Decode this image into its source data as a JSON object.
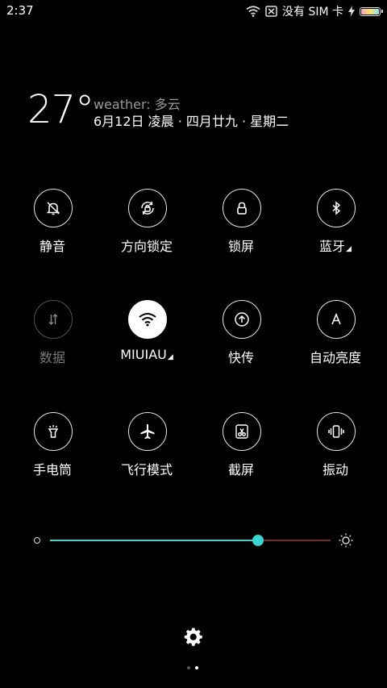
{
  "status_bar": {
    "time": "2:37",
    "carrier": "没有 SIM 卡",
    "battery_level": 1.0
  },
  "weather": {
    "temperature": "27°",
    "summary": "weather:  多云",
    "date": "6月12日 凌晨 · 四月廿九 · 星期二"
  },
  "toggles": [
    {
      "label": "静音",
      "icon": "silent-bell-icon",
      "state": "on"
    },
    {
      "label": "方向锁定",
      "icon": "rotation-lock-icon",
      "state": "on"
    },
    {
      "label": "锁屏",
      "icon": "lock-icon",
      "state": "on"
    },
    {
      "label": "蓝牙",
      "icon": "bluetooth-icon",
      "state": "on",
      "has_menu": true
    },
    {
      "label": "数据",
      "icon": "mobile-data-icon",
      "state": "disabled"
    },
    {
      "label": "MIUIAU",
      "icon": "wifi-icon",
      "state": "active",
      "has_menu": true
    },
    {
      "label": "快传",
      "icon": "quick-transfer-icon",
      "state": "on"
    },
    {
      "label": "自动亮度",
      "icon": "auto-brightness-icon",
      "state": "on"
    },
    {
      "label": "手电筒",
      "icon": "flashlight-icon",
      "state": "on"
    },
    {
      "label": "飞行模式",
      "icon": "airplane-icon",
      "state": "on"
    },
    {
      "label": "截屏",
      "icon": "screenshot-icon",
      "state": "on"
    },
    {
      "label": "振动",
      "icon": "vibrate-icon",
      "state": "on"
    }
  ],
  "brightness": {
    "level": 0.74,
    "fill_color": "#3ad7d2",
    "track_color": "#7a2a2a"
  },
  "pagination": {
    "pages": 2,
    "current": 2
  }
}
